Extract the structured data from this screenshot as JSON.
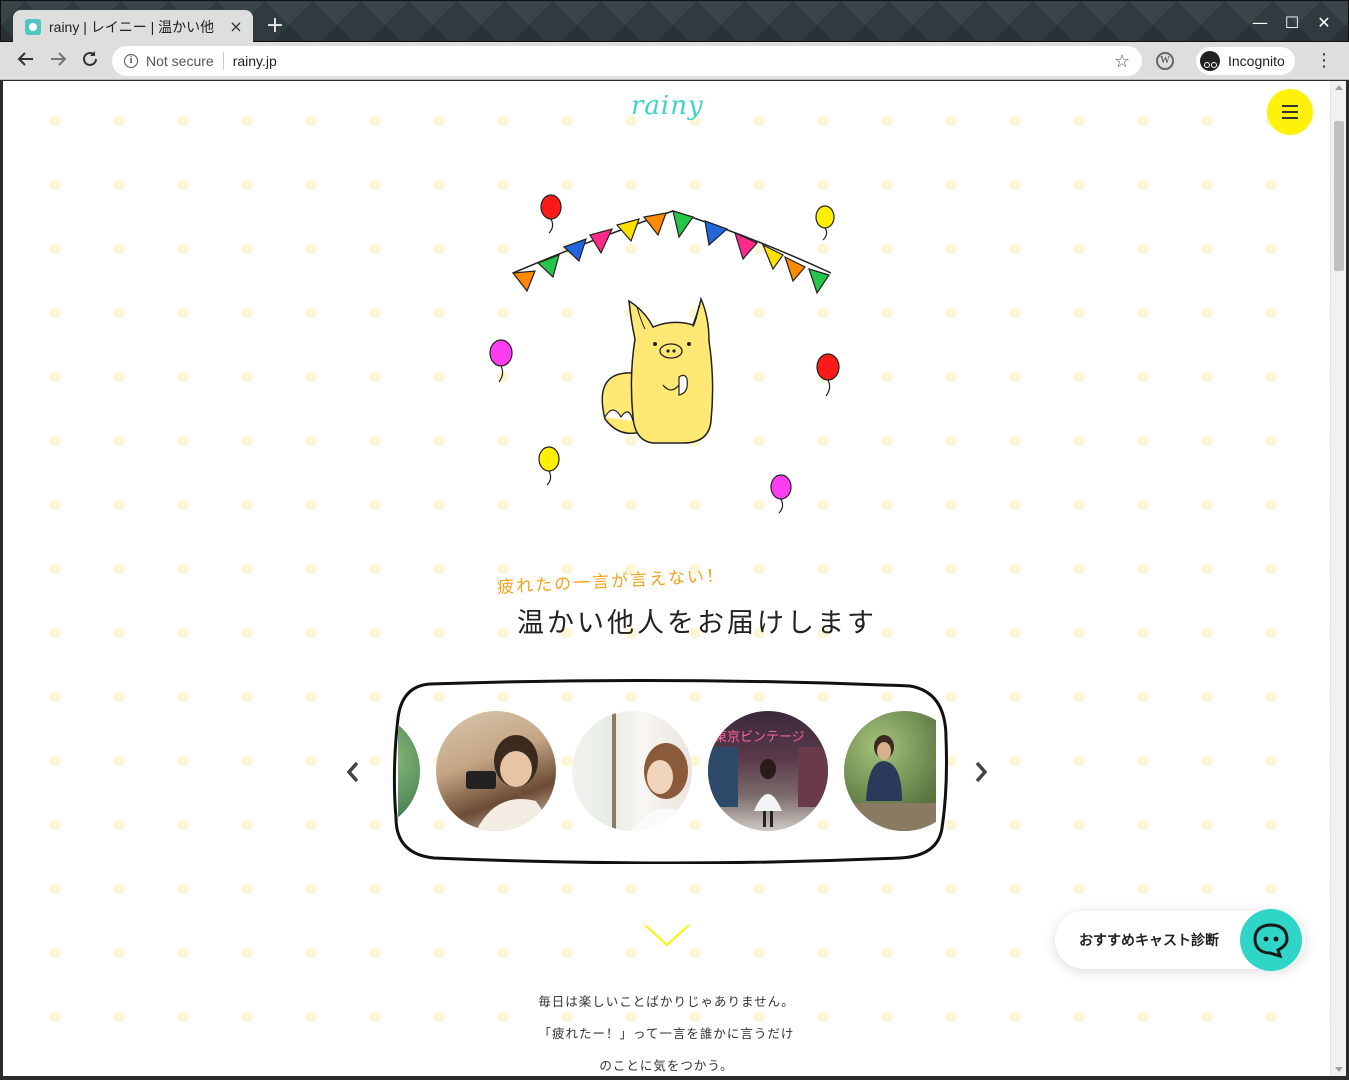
{
  "browser": {
    "tab_title": "rainy | レイニー | 温かい他",
    "tab_close": "×",
    "new_tab": "+",
    "window_controls": [
      "—",
      "☐",
      "✕"
    ],
    "security_label": "Not secure",
    "url": "rainy.jp",
    "profile_label": "Incognito"
  },
  "header": {
    "logo": "rainy"
  },
  "hero": {
    "tagline": "疲れたの一言が言えない！",
    "headline": "温かい他人をお届けします"
  },
  "carousel": {
    "prev_icon": "chevron-left-icon",
    "next_icon": "chevron-right-icon",
    "photos": [
      {
        "name": "cast-photo-1",
        "theme": "#4a8a5a"
      },
      {
        "name": "cast-photo-2",
        "theme": "#b08e6b"
      },
      {
        "name": "cast-photo-3",
        "theme": "#e8e4df"
      },
      {
        "name": "cast-photo-4",
        "theme": "#4a3d45"
      },
      {
        "name": "cast-photo-5",
        "theme": "#5f7a45"
      }
    ]
  },
  "intro": {
    "lines": [
      "毎日は楽しいことばかりじゃありません。",
      "「疲れたー！」って一言を誰かに言うだけ",
      "のことに気をつかう。"
    ]
  },
  "recommend": {
    "label": "おすすめキャスト診断"
  },
  "colors": {
    "brand_teal": "#3cd3c8",
    "brand_yellow": "#fff20a",
    "tagline_orange": "#f5a21e",
    "chat_teal": "#2fd6c8"
  }
}
